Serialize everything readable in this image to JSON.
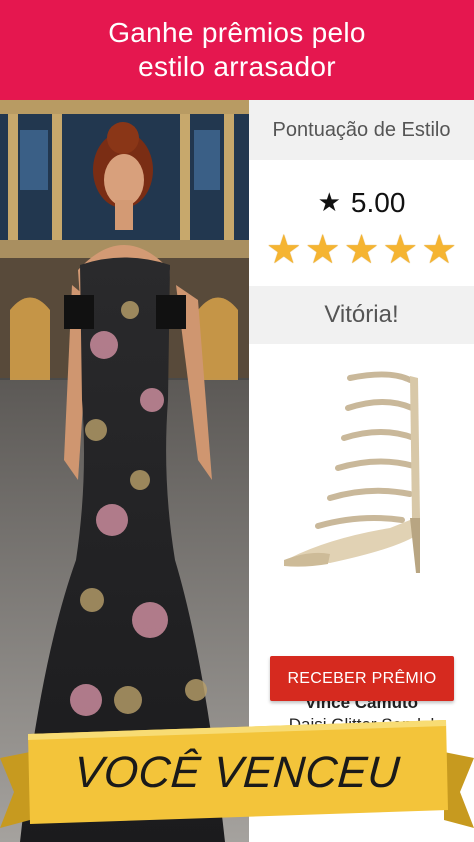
{
  "header": {
    "line1": "Ganhe prêmios pelo",
    "line2": "estilo arrasador"
  },
  "panel": {
    "style_score_label": "Pontuação de Estilo",
    "score_icon": "star-icon",
    "score_value": "5.00",
    "rating_stars": 5,
    "victory_label": "Vitória!"
  },
  "reward": {
    "image_icon": "glitter-sandal-image",
    "brand": "Vince Camuto",
    "product_name": "Daisi Glitter Sandal",
    "claim_button_label": "RECEBER PRÊMIO"
  },
  "banner": {
    "text": "VOCÊ VENCEU"
  },
  "colors": {
    "header_bg": "#e5174f",
    "button_bg": "#d62a1f",
    "star": "#f5b431",
    "banner": "#f3c43a"
  }
}
